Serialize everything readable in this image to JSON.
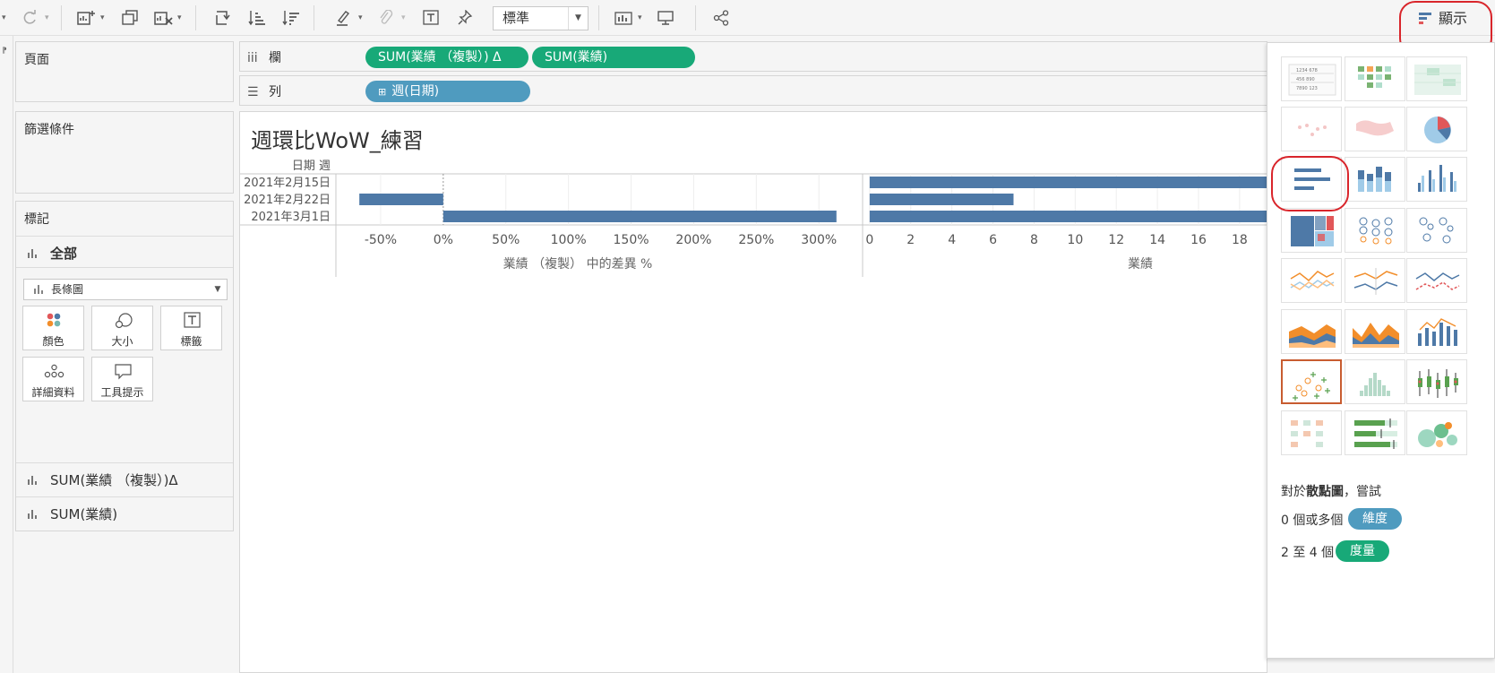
{
  "toolbar": {
    "fit_select": "標準",
    "show_me_label": "顯示"
  },
  "side": {
    "pages_label": "頁面",
    "filters_label": "篩選條件",
    "marks_label": "標記",
    "marks_all": "全部",
    "mark_type": "長條圖",
    "buttons": [
      "顏色",
      "大小",
      "標籤",
      "詳細資料",
      "工具提示"
    ],
    "measures": [
      "SUM(業績 （複製）)Δ",
      "SUM(業績)"
    ]
  },
  "shelves": {
    "columns_label": "欄",
    "rows_label": "列",
    "column_pills": [
      "SUM(業績 （複製）)  Δ",
      "SUM(業績)"
    ],
    "row_pills": [
      "週(日期)"
    ]
  },
  "viz": {
    "title": "週環比WoW_練習"
  },
  "chart_data": {
    "type": "bar",
    "orientation": "horizontal",
    "row_header": "日期 週",
    "categories": [
      "2021年2月15日",
      "2021年2月22日",
      "2021年3月1日"
    ],
    "panes": [
      {
        "name": "業績 （複製） 中的差異 %",
        "xlabel": "業績 （複製） 中的差異 %",
        "values": [
          null,
          -0.67,
          3.14
        ],
        "xlim": [
          -0.85,
          3.17
        ],
        "ticks": [
          "-50%",
          "0%",
          "50%",
          "100%",
          "150%",
          "200%",
          "250%",
          "300%"
        ],
        "tick_values": [
          -0.5,
          0,
          0.5,
          1,
          1.5,
          2,
          2.5,
          3
        ]
      },
      {
        "name": "業績",
        "xlabel": "業績",
        "values": [
          21,
          7,
          22
        ],
        "xlim": [
          -0.3,
          19.4
        ],
        "ticks": [
          "0",
          "2",
          "4",
          "6",
          "8",
          "10",
          "12",
          "14",
          "16",
          "18"
        ],
        "tick_values": [
          0,
          2,
          4,
          6,
          8,
          10,
          12,
          14,
          16,
          18
        ]
      }
    ],
    "bar_color": "#4e79a7",
    "grid": true
  },
  "show_me": {
    "hint_prefix": "對於",
    "hint_chart": "散點圖",
    "hint_suffix": "，嘗試",
    "req1_text": "0 個或多個",
    "req1_pill": "維度",
    "req2_text": "2 至 4 個",
    "req2_pill": "度量",
    "colors": {
      "dimension": "#4f9bbf",
      "measure": "#18a978"
    }
  }
}
